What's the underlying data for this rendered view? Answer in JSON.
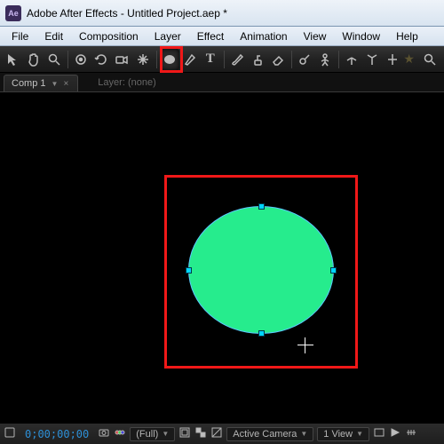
{
  "title": "Adobe After Effects - Untitled Project.aep *",
  "app_icon_text": "Ae",
  "menu": [
    "File",
    "Edit",
    "Composition",
    "Layer",
    "Effect",
    "Animation",
    "View",
    "Window",
    "Help"
  ],
  "tabs": {
    "comp": "Comp 1"
  },
  "layer_crumb_label": "Layer:",
  "layer_crumb_value": "(none)",
  "tools": {
    "text_tool_glyph": "T"
  },
  "shape": {
    "fill": "#26ec8d",
    "stroke": "#5ac8ff"
  },
  "footer": {
    "timecode": "0;00;00;00",
    "res": "(Full)",
    "camera": "Active Camera",
    "views": "1 View"
  },
  "highlight_color": "#f01818"
}
